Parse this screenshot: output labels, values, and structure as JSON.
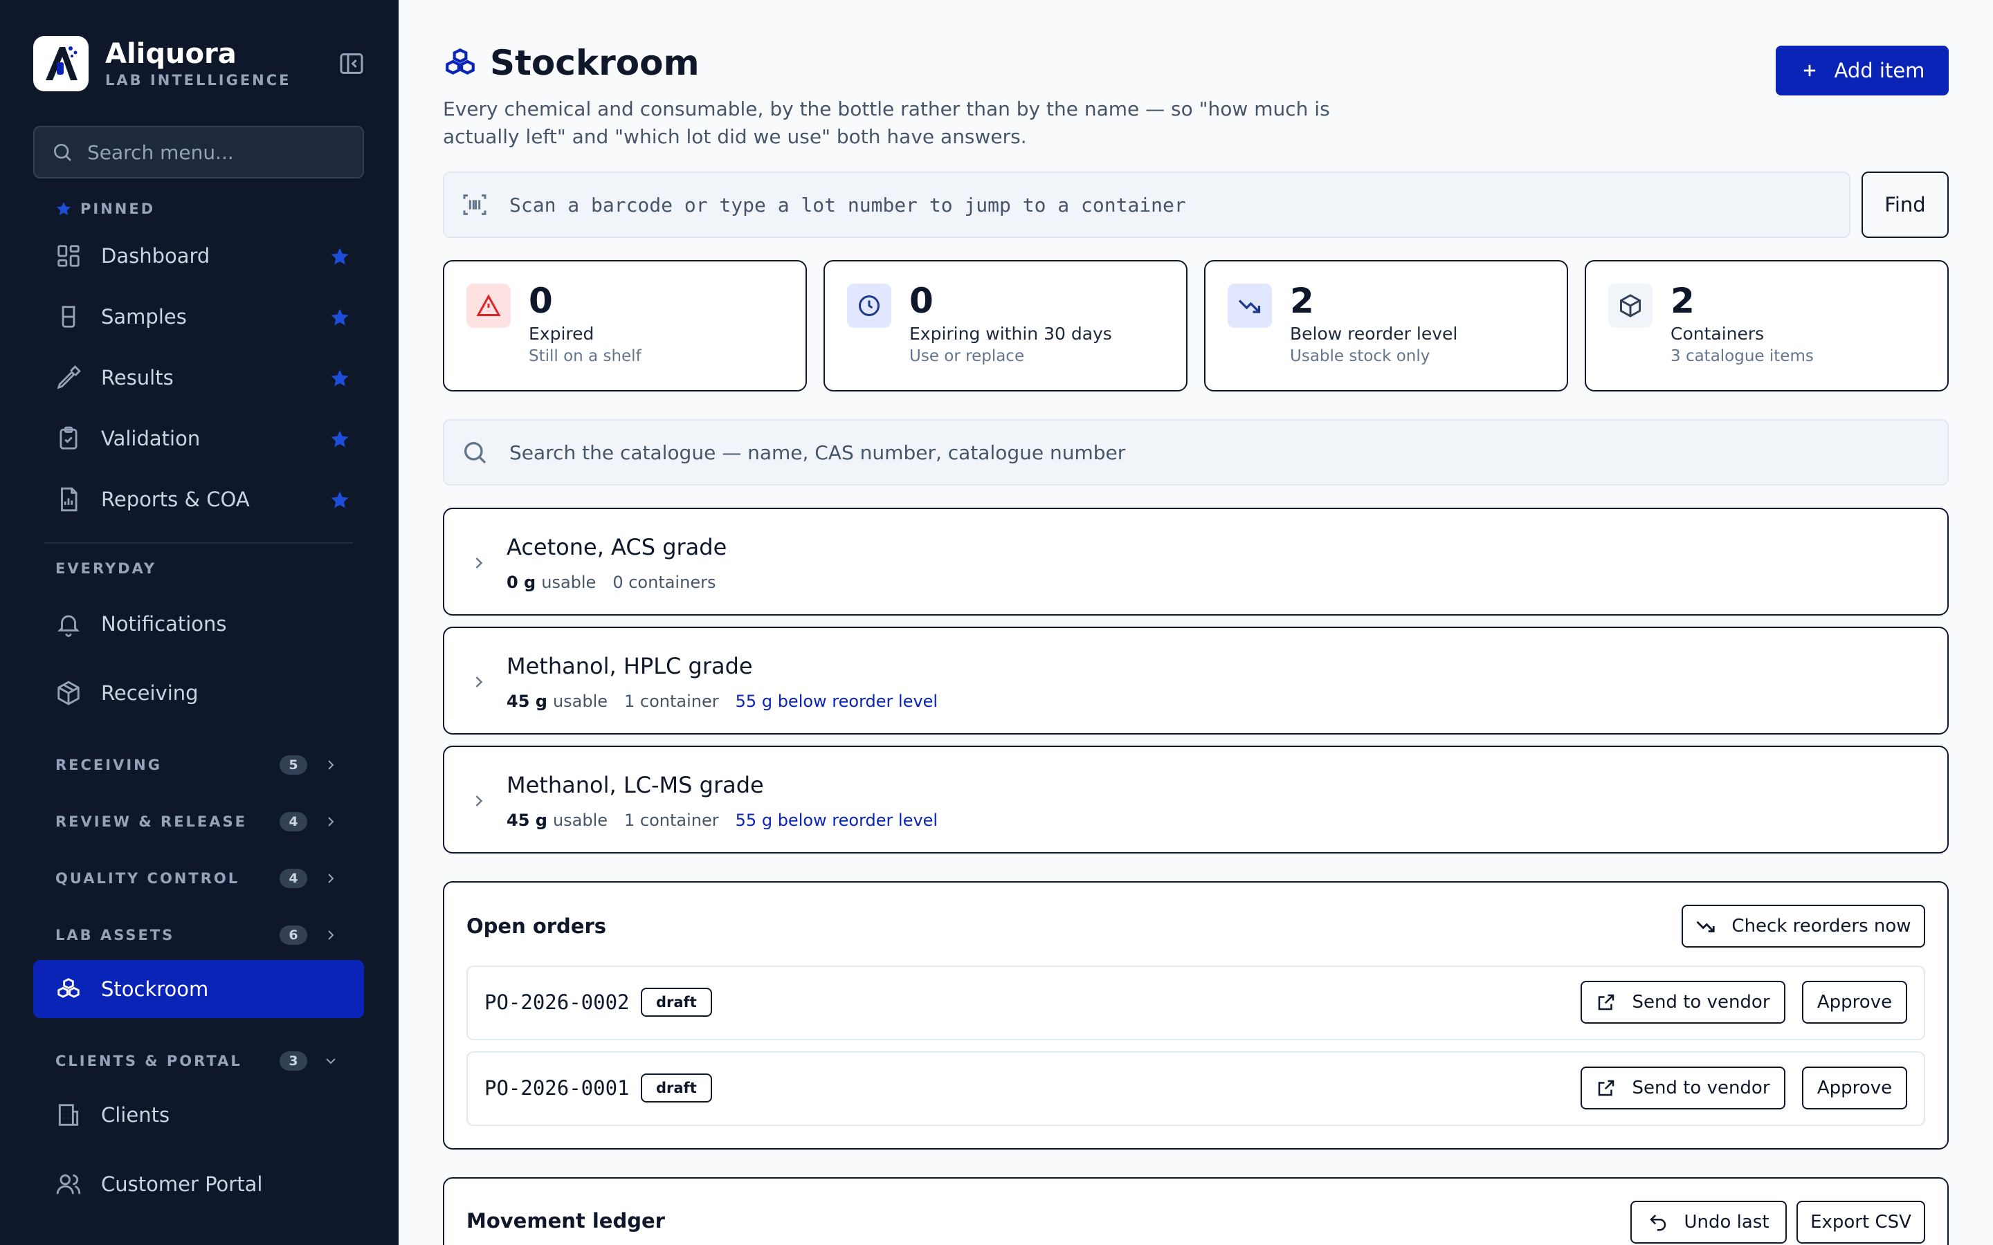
{
  "sidebar": {
    "brand_name": "Aliquora",
    "brand_sub": "LAB INTELLIGENCE",
    "search_placeholder": "Search menu...",
    "pinned_label": "PINNED",
    "pinned": [
      {
        "label": "Dashboard",
        "icon": "dashboard-icon"
      },
      {
        "label": "Samples",
        "icon": "beaker-icon"
      },
      {
        "label": "Results",
        "icon": "pipette-icon"
      },
      {
        "label": "Validation",
        "icon": "clipboard-check-icon"
      },
      {
        "label": "Reports & COA",
        "icon": "report-icon"
      }
    ],
    "everyday_label": "EVERYDAY",
    "everyday": [
      {
        "label": "Notifications",
        "icon": "bell-icon"
      },
      {
        "label": "Receiving",
        "icon": "package-icon"
      }
    ],
    "groups": [
      {
        "label": "RECEIVING",
        "count": "5"
      },
      {
        "label": "REVIEW & RELEASE",
        "count": "4"
      },
      {
        "label": "QUALITY CONTROL",
        "count": "4"
      },
      {
        "label": "LAB ASSETS",
        "count": "6"
      }
    ],
    "active_item": "Stockroom",
    "clients_group": {
      "label": "CLIENTS & PORTAL",
      "count": "3"
    },
    "clients_items": [
      {
        "label": "Clients",
        "icon": "building-icon"
      },
      {
        "label": "Customer Portal",
        "icon": "users-icon"
      }
    ]
  },
  "header": {
    "title": "Stockroom",
    "subtitle": "Every chemical and consumable, by the bottle rather than by the name — so \"how much is actually left\" and \"which lot did we use\" both have answers.",
    "add_button": "Add item"
  },
  "scan": {
    "placeholder": "Scan a barcode or type a lot number to jump to a container",
    "find_button": "Find"
  },
  "stats": [
    {
      "value": "0",
      "label": "Expired",
      "sub": "Still on a shelf",
      "icon": "alert-triangle-icon",
      "color": "#dc2626",
      "bg": "#fee2e2"
    },
    {
      "value": "0",
      "label": "Expiring within 30 days",
      "sub": "Use or replace",
      "icon": "clock-icon",
      "color": "#1e3a8a",
      "bg": "#e0e7ff"
    },
    {
      "value": "2",
      "label": "Below reorder level",
      "sub": "Usable stock only",
      "icon": "trending-down-icon",
      "color": "#1e3a8a",
      "bg": "#e0e7ff"
    },
    {
      "value": "2",
      "label": "Containers",
      "sub": "3 catalogue items",
      "icon": "box-icon",
      "color": "#334155",
      "bg": "#f1f5f9"
    }
  ],
  "catalogue": {
    "search_placeholder": "Search the catalogue — name, CAS number, catalogue number",
    "items": [
      {
        "name": "Acetone, ACS grade",
        "qty": "0 g",
        "usable": "usable",
        "containers": "0 containers",
        "warning": ""
      },
      {
        "name": "Methanol, HPLC grade",
        "qty": "45 g",
        "usable": "usable",
        "containers": "1 container",
        "warning": "55 g below reorder level"
      },
      {
        "name": "Methanol, LC-MS grade",
        "qty": "45 g",
        "usable": "usable",
        "containers": "1 container",
        "warning": "55 g below reorder level"
      }
    ]
  },
  "orders": {
    "title": "Open orders",
    "check_button": "Check reorders now",
    "rows": [
      {
        "po": "PO-2026-0002",
        "status": "draft",
        "send": "Send to vendor",
        "approve": "Approve"
      },
      {
        "po": "PO-2026-0001",
        "status": "draft",
        "send": "Send to vendor",
        "approve": "Approve"
      }
    ]
  },
  "ledger": {
    "title": "Movement ledger",
    "undo_button": "Undo last",
    "export_button": "Export CSV"
  },
  "colors": {
    "accent": "#0b24b8",
    "sidebar_bg": "#0f172a",
    "pin_star": "#1d4ed8"
  }
}
